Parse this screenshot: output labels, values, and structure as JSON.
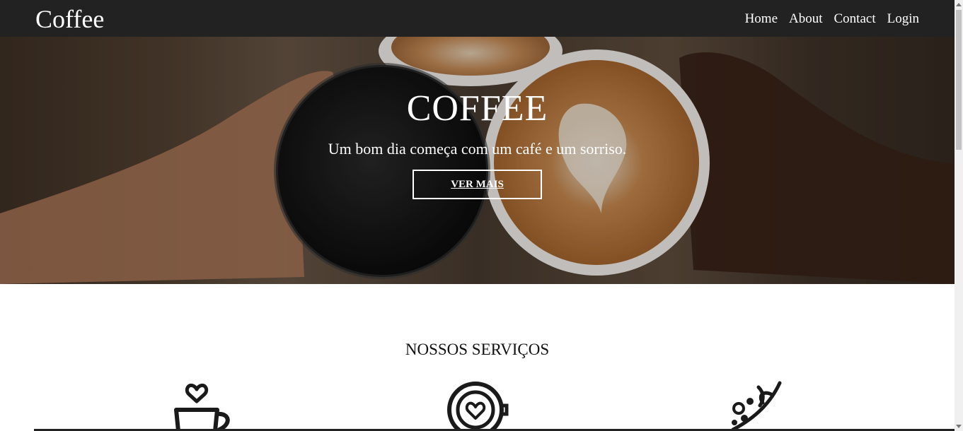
{
  "navbar": {
    "brand": "Coffee",
    "links": [
      "Home",
      "About",
      "Contact",
      "Login"
    ]
  },
  "hero": {
    "title": "COFFEE",
    "subtitle": "Um bom dia começa com um café e um sorriso.",
    "button_label": "VER MAIS"
  },
  "services": {
    "title": "NOSSOS SERVIÇOS",
    "icons": [
      "coffee-cup-heart-icon",
      "latte-art-heart-icon",
      "coffee-branch-icon"
    ]
  },
  "colors": {
    "navbar_bg": "#222222",
    "text_light": "#ffffff",
    "text_dark": "#111111"
  }
}
